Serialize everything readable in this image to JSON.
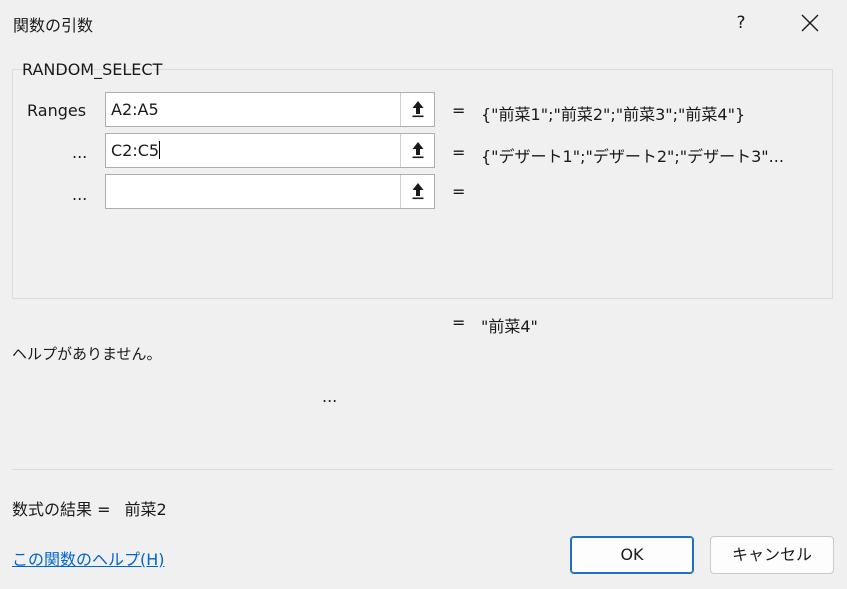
{
  "window": {
    "title": "関数の引数",
    "help_label": "?",
    "close_icon": "close-icon"
  },
  "function": {
    "name": "RANDOM_SELECT"
  },
  "args": [
    {
      "label": "Ranges",
      "value": "A2:A5",
      "eq": "=",
      "result": "{\"前菜1\";\"前菜2\";\"前菜3\";\"前菜4\"}"
    },
    {
      "label": "...",
      "value": "C2:C5",
      "eq": "=",
      "result": "{\"デザート1\";\"デザート2\";\"デザート3\"..."
    },
    {
      "label": "...",
      "value": "",
      "eq": "=",
      "result": ""
    }
  ],
  "result": {
    "eq": "=",
    "value": "\"前菜4\""
  },
  "description": "ヘルプがありません。",
  "arg_description": "...",
  "formula_result": {
    "label": "数式の結果 =",
    "value": "前菜2"
  },
  "help_link": "この関数のヘルプ(H)",
  "buttons": {
    "ok": "OK",
    "cancel": "キャンセル"
  }
}
